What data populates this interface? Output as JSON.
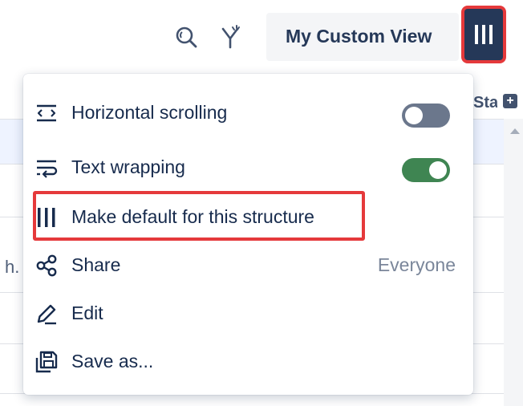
{
  "toolbar": {
    "search_icon": "search-icon",
    "filter_icon": "filter-icon",
    "view_name": "My Custom View",
    "columns_icon": "columns-icon"
  },
  "background": {
    "column_header_partial": "Stat",
    "add_column_icon": "plus-icon",
    "cell_text_partial": "h."
  },
  "menu": {
    "horizontal_scrolling": {
      "label": "Horizontal scrolling",
      "enabled": false,
      "icon": "horizontal-scroll-icon"
    },
    "text_wrapping": {
      "label": "Text wrapping",
      "enabled": true,
      "icon": "text-wrap-icon"
    },
    "make_default": {
      "label": "Make default for this structure",
      "icon": "columns-icon"
    },
    "share": {
      "label": "Share",
      "value": "Everyone",
      "icon": "share-icon"
    },
    "edit": {
      "label": "Edit",
      "icon": "pencil-icon"
    },
    "save_as": {
      "label": "Save as...",
      "icon": "save-as-icon"
    }
  },
  "colors": {
    "toggle_on": "#3f8552",
    "toggle_off": "#6b778c",
    "highlight": "#e5393b",
    "primary_dark": "#253858"
  }
}
